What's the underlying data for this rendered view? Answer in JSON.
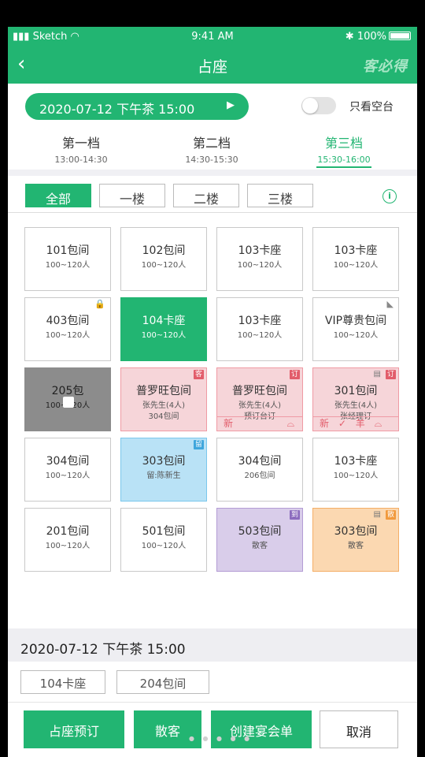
{
  "status": {
    "carrier": "Sketch",
    "time": "9:41 AM",
    "battery": "100%"
  },
  "nav": {
    "back_icon": "‹",
    "title": "占座",
    "brand": "客必得"
  },
  "date_pill": {
    "label": "2020-07-12 下午茶 15:00",
    "arrow": "▶"
  },
  "only_free": {
    "label": "只看空台",
    "on": false
  },
  "time_slots": [
    {
      "name": "第一档",
      "time": "13:00-14:30"
    },
    {
      "name": "第二档",
      "time": "14:30-15:30"
    },
    {
      "name": "第三档",
      "time": "15:30-16:00"
    }
  ],
  "floors": [
    "全部",
    "一楼",
    "二楼",
    "三楼"
  ],
  "info_icon": "i",
  "tables": [
    {
      "name": "101包间",
      "sub": "100~120人"
    },
    {
      "name": "102包间",
      "sub": "100~120人"
    },
    {
      "name": "103卡座",
      "sub": "100~120人"
    },
    {
      "name": "103卡座",
      "sub": "100~120人"
    },
    {
      "name": "403包间",
      "sub": "100~120人",
      "corner": "🔒"
    },
    {
      "name": "104卡座",
      "sub": "100~120人"
    },
    {
      "name": "103卡座",
      "sub": "100~120人"
    },
    {
      "name": "VIP尊贵包间",
      "sub": "100~120人",
      "corner": "◣"
    },
    {
      "name": "205包",
      "sub": "100~120人"
    },
    {
      "name": "普罗旺包间",
      "sub": "张先生(4人)",
      "sub2": "304包间",
      "corner": "客"
    },
    {
      "name": "普罗旺包间",
      "sub": "张先生(4人)",
      "sub2": "预订台订",
      "corner": "订",
      "bottom": [
        "新",
        "⌓"
      ]
    },
    {
      "name": "301包间",
      "sub": "张先生(4人)",
      "sub2": "张经理订",
      "corner": "订",
      "msg": "▤",
      "bottom": [
        "新",
        "✓",
        "羊",
        "⌓"
      ]
    },
    {
      "name": "304包间",
      "sub": "100~120人"
    },
    {
      "name": "303包间",
      "sub": "留:陈新生",
      "corner": "留"
    },
    {
      "name": "304包间",
      "sub": "206包间"
    },
    {
      "name": "103卡座",
      "sub": "100~120人"
    },
    {
      "name": "201包间",
      "sub": "100~120人"
    },
    {
      "name": "501包间",
      "sub": "100~120人"
    },
    {
      "name": "503包间",
      "sub": "散客",
      "corner": "到"
    },
    {
      "name": "303包间",
      "sub": "散客",
      "corner": "散",
      "msg": "▤"
    }
  ],
  "selection": {
    "date": "2020-07-12 下午茶 15:00",
    "chips": [
      "104卡座",
      "204包间"
    ]
  },
  "actions": {
    "reserve": "占座预订",
    "walkin": "散客",
    "banquet": "创建宴会单",
    "cancel": "取消"
  },
  "colors": {
    "accent": "#22b572",
    "pink": "#f6d5d9",
    "blue": "#b9e2f6",
    "purple": "#d9cdea",
    "orange": "#fbd8b1",
    "gray": "#8c8c8c"
  }
}
